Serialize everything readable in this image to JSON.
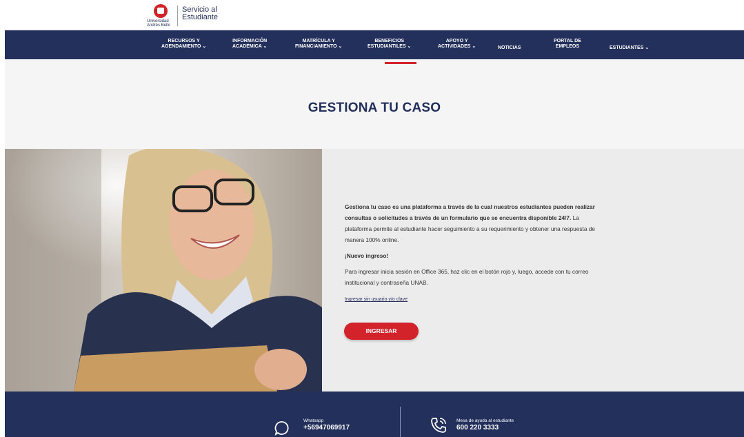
{
  "brand": {
    "university": "Universidad Andrés Bello",
    "service": "Servicio al Estudiante",
    "accent": "#d2232a",
    "navy": "#23305b"
  },
  "nav": {
    "items": [
      {
        "label": "RECURSOS Y\nAGENDAMIENTO ⌄"
      },
      {
        "label": "INFORMACIÓN\nACADÉMICA ⌄"
      },
      {
        "label": "MATRÍCULA Y\nFINANCIAMIENTO ⌄"
      },
      {
        "label": "BENEFICIOS\nESTUDIANTILES ⌄"
      },
      {
        "label": "APOYO Y\nACTIVIDADES ⌄"
      },
      {
        "label": "NOTICIAS"
      },
      {
        "label": "PORTAL DE\nEMPLEOS"
      },
      {
        "label": "ESTUDIANTES ⌄"
      }
    ]
  },
  "hero": {
    "title": "GESTIONA TU CASO"
  },
  "content": {
    "intro_bold": "Gestiona tu caso es una plataforma a través de la cual nuestros estudiantes pueden realizar consultas o solicitudes a través de un formulario que se encuentra disponible 24/7.",
    "intro_rest": " La plataforma permite al estudiante hacer seguimiento a su requerimiento y obtener una respuesta de manera 100% online.",
    "new_login": "¡Nuevo ingreso!",
    "instructions": "Para ingresar inicia sesión en Office 365, haz clic en el botón rojo y, luego, accede con tu correo institucional y contraseña UNAB.",
    "link_text": "Ingresar sin usuario y/o clave",
    "button_label": "INGRESAR"
  },
  "footer": {
    "whatsapp_label": "Whatsapp",
    "whatsapp_number": "+56947069917",
    "help_label": "Mesa de ayuda al estudiante",
    "help_number": "600 220 3333",
    "icons": [
      "whatsapp-icon",
      "phone-icon"
    ]
  }
}
